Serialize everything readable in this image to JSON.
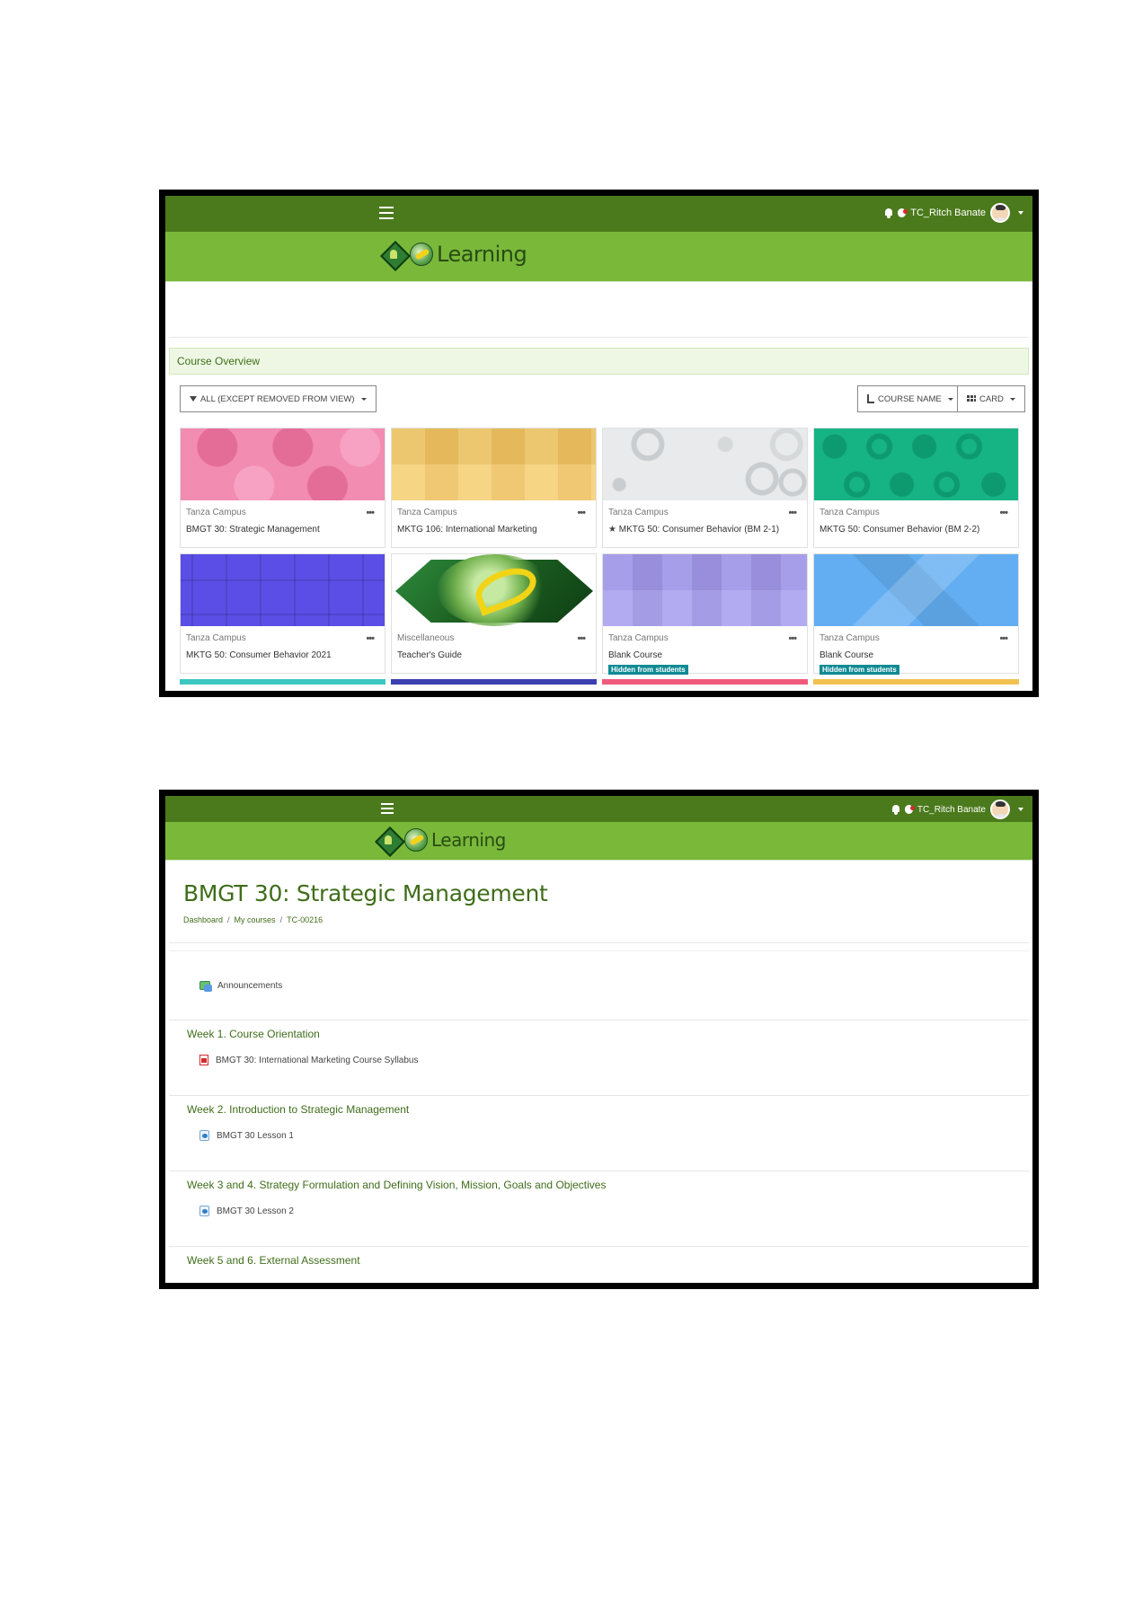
{
  "screenshot1": {
    "header": {
      "user_name": "TC_Ritch Banate",
      "brand_text": "Learning"
    },
    "overview": {
      "title": "Course Overview",
      "filter_label": "ALL (EXCEPT REMOVED FROM VIEW)",
      "sort_label": "COURSE NAME",
      "view_label": "CARD"
    },
    "cards": [
      {
        "category": "Tanza Campus",
        "name": "BMGT 30: Strategic Management",
        "starred": false,
        "hidden_badge": ""
      },
      {
        "category": "Tanza Campus",
        "name": "MKTG 106: International Marketing",
        "starred": false,
        "hidden_badge": ""
      },
      {
        "category": "Tanza Campus",
        "name": "MKTG 50: Consumer Behavior (BM 2-1)",
        "starred": true,
        "hidden_badge": ""
      },
      {
        "category": "Tanza Campus",
        "name": "MKTG 50: Consumer Behavior (BM 2-2)",
        "starred": false,
        "hidden_badge": ""
      },
      {
        "category": "Tanza Campus",
        "name": "MKTG 50: Consumer Behavior 2021",
        "starred": false,
        "hidden_badge": ""
      },
      {
        "category": "Miscellaneous",
        "name": "Teacher's Guide",
        "starred": false,
        "hidden_badge": ""
      },
      {
        "category": "Tanza Campus",
        "name": "Blank Course",
        "starred": false,
        "hidden_badge": "Hidden from students"
      },
      {
        "category": "Tanza Campus",
        "name": "Blank Course",
        "starred": false,
        "hidden_badge": "Hidden from students"
      }
    ],
    "more_glyph": "•••",
    "star_glyph": "★"
  },
  "screenshot2": {
    "header": {
      "user_name": "TC_Ritch Banate",
      "brand_text": "Learning"
    },
    "course_title": "BMGT 30: Strategic Management",
    "breadcrumb": [
      "Dashboard",
      "My courses",
      "TC-00216"
    ],
    "breadcrumb_sep": "/",
    "announcements_label": "Announcements",
    "sections": [
      {
        "title": "Week 1. Course Orientation",
        "activity": "BMGT 30: International Marketing Course Syllabus",
        "icon": "pdf-icon"
      },
      {
        "title": "Week 2. Introduction to Strategic Management",
        "activity": "BMGT 30 Lesson 1",
        "icon": "file-icon"
      },
      {
        "title": "Week 3 and 4. Strategy Formulation and Defining Vision, Mission, Goals and Objectives",
        "activity": "BMGT 30 Lesson 2",
        "icon": "file-icon"
      },
      {
        "title": "Week 5 and 6. External Assessment",
        "activity": "",
        "icon": ""
      }
    ]
  },
  "colors": {
    "topbar": "#4b7a1c",
    "brandbar": "#7ab83a",
    "accent_text": "#3f6d1a",
    "hidden_badge": "#0f8a94"
  }
}
